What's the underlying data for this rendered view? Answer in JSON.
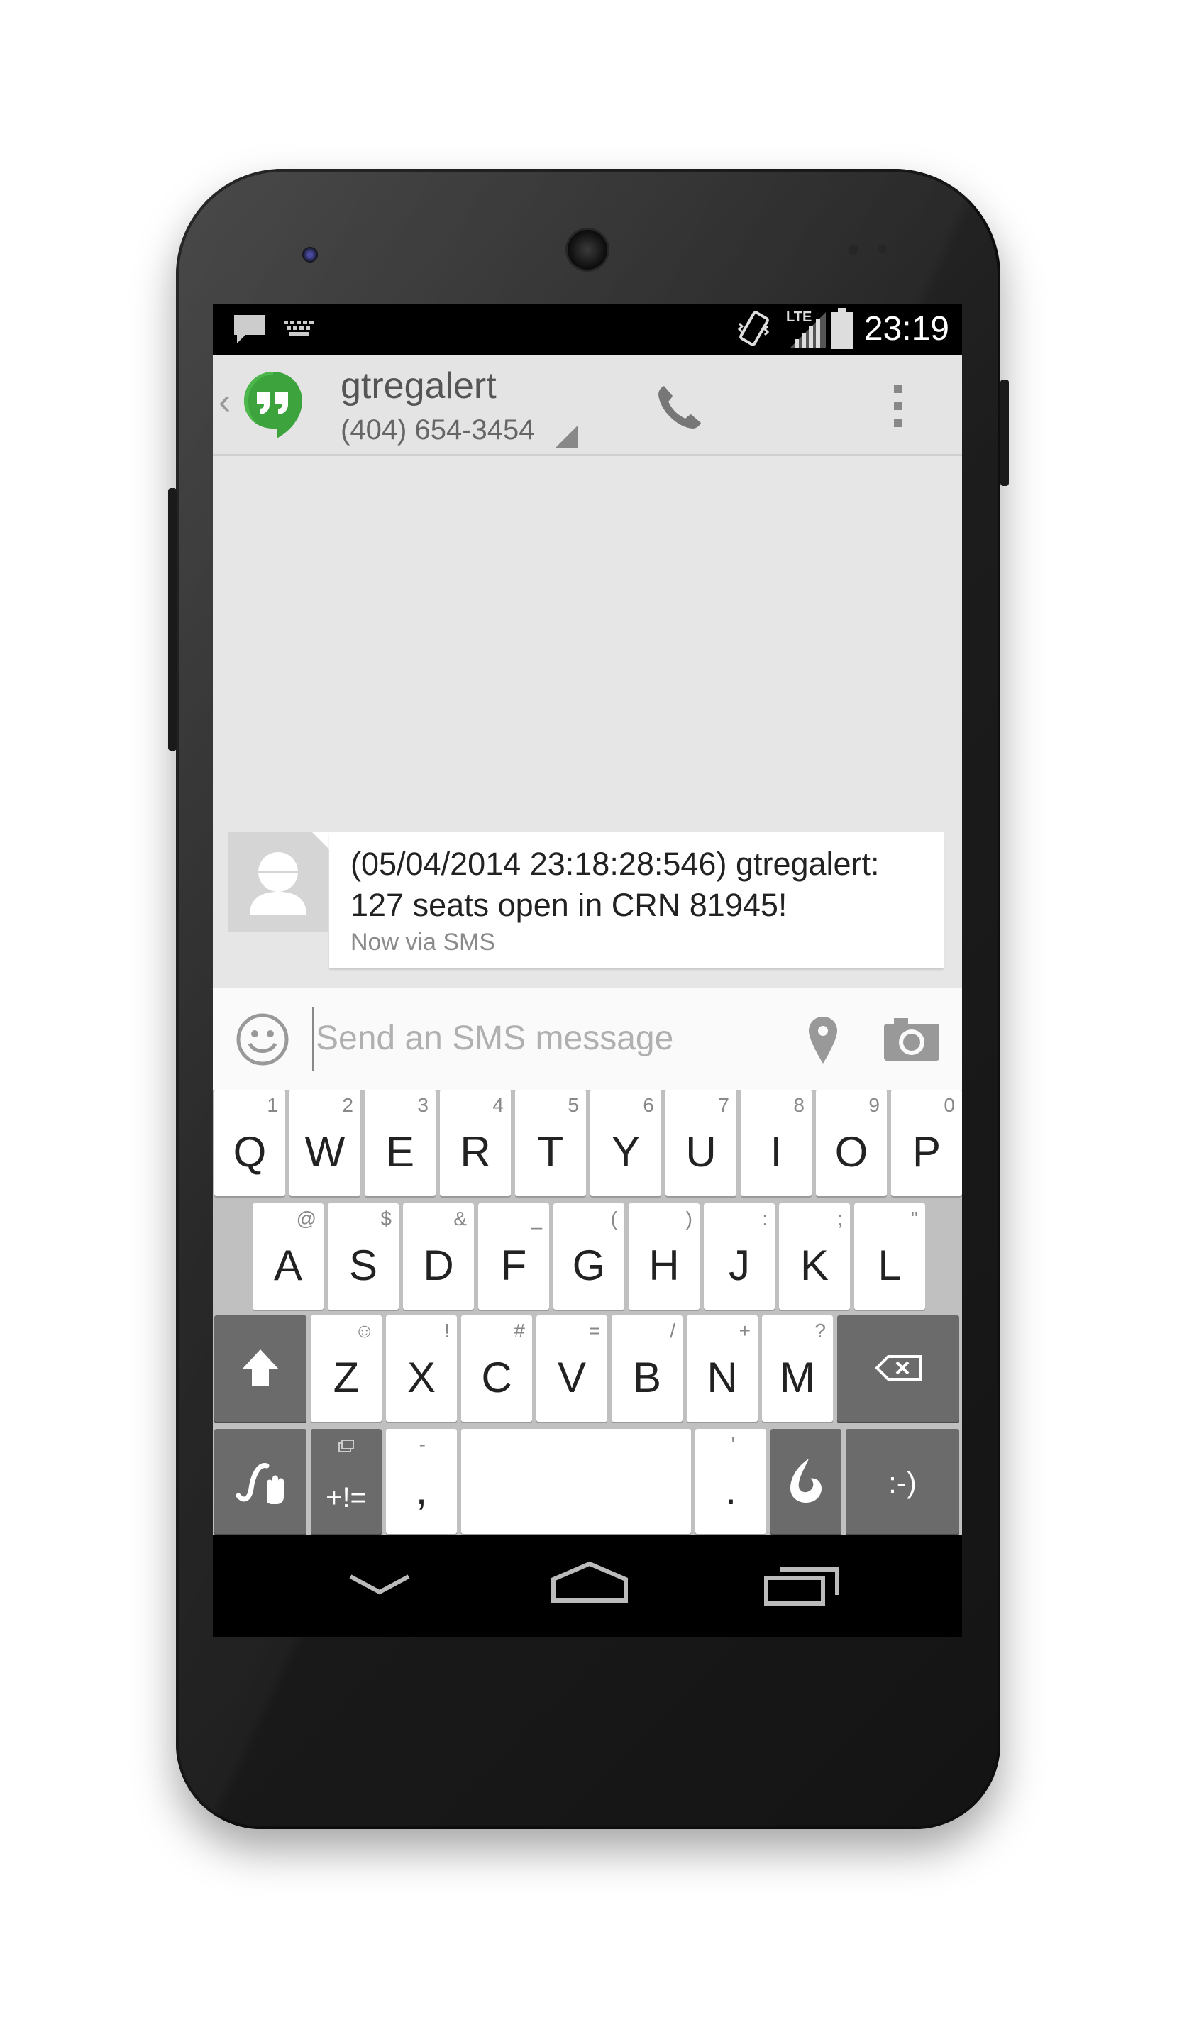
{
  "status_bar": {
    "time": "23:19",
    "network": "LTE",
    "icons": [
      "message-icon",
      "keyboard-icon",
      "vibrate-icon",
      "signal-icon",
      "battery-icon"
    ]
  },
  "action_bar": {
    "contact_name": "gtregalert",
    "contact_number": "(404) 654-3454",
    "icons": [
      "back-chevron-icon",
      "hangouts-logo-icon",
      "phone-icon",
      "overflow-menu-icon"
    ]
  },
  "conversation": {
    "messages": [
      {
        "text": "(05/04/2014 23:18:28:546) gtregalert: 127 seats open in CRN 81945!",
        "meta": "Now via SMS"
      }
    ]
  },
  "compose": {
    "placeholder": "Send an SMS message",
    "icons": [
      "emoji-icon",
      "location-pin-icon",
      "camera-icon"
    ]
  },
  "keyboard": {
    "row1": [
      {
        "main": "Q",
        "alt": "1"
      },
      {
        "main": "W",
        "alt": "2"
      },
      {
        "main": "E",
        "alt": "3"
      },
      {
        "main": "R",
        "alt": "4"
      },
      {
        "main": "T",
        "alt": "5"
      },
      {
        "main": "Y",
        "alt": "6"
      },
      {
        "main": "U",
        "alt": "7"
      },
      {
        "main": "I",
        "alt": "8"
      },
      {
        "main": "O",
        "alt": "9"
      },
      {
        "main": "P",
        "alt": "0"
      }
    ],
    "row2": [
      {
        "main": "A",
        "alt": "@"
      },
      {
        "main": "S",
        "alt": "$"
      },
      {
        "main": "D",
        "alt": "&"
      },
      {
        "main": "F",
        "alt": "_"
      },
      {
        "main": "G",
        "alt": "("
      },
      {
        "main": "H",
        "alt": ")"
      },
      {
        "main": "J",
        "alt": ":"
      },
      {
        "main": "K",
        "alt": ";"
      },
      {
        "main": "L",
        "alt": "\""
      }
    ],
    "row3": [
      {
        "main": "Z",
        "alt": "☺"
      },
      {
        "main": "X",
        "alt": "!"
      },
      {
        "main": "C",
        "alt": "#"
      },
      {
        "main": "V",
        "alt": "="
      },
      {
        "main": "B",
        "alt": "/"
      },
      {
        "main": "N",
        "alt": "+"
      },
      {
        "main": "M",
        "alt": "?"
      }
    ],
    "symbols_label": "+!=",
    "comma": {
      "main": ",",
      "alt": "-"
    },
    "period": {
      "main": ".",
      "alt": "'"
    },
    "smiley_label": ":-)"
  },
  "nav_bar": {
    "icons": [
      "back-icon",
      "home-icon",
      "recents-icon"
    ]
  }
}
